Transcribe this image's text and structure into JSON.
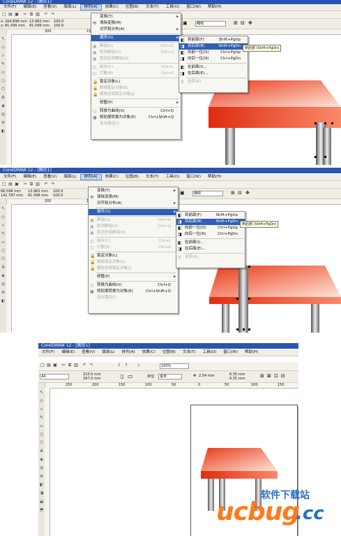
{
  "app_title_1": "CorelDRAW 12 - [图形1]",
  "app_title_2": "CorelDRAW 12 - [图形1]",
  "app_title_3": "CorelDRAW 12 - [图形1]",
  "menubar": [
    "文件(F)",
    "编辑(E)",
    "查看(V)",
    "版面(L)",
    "排列(A)",
    "效果(C)",
    "位图(B)",
    "文本(T)",
    "工具(O)",
    "窗口(W)",
    "帮助(H)"
  ],
  "panel1": {
    "x_pos": "164.898 mm",
    "y_pos": "81.096 mm",
    "w": "13.982 mm",
    "h": "81.096 mm",
    "scale_x": "100.0",
    "scale_y": "100.0",
    "outline": "细线",
    "ruler_ticks": [
      "200",
      "150"
    ]
  },
  "panel2": {
    "x_pos": "66.598 mm",
    "y_pos": "141.787 mm",
    "w": "13.982 mm",
    "h": "81.096 mm",
    "scale_x": "100.0",
    "scale_y": "100.0",
    "outline": "细线",
    "ruler_ticks": [
      "200",
      "150"
    ]
  },
  "panel3": {
    "page_size": "A4",
    "width": "210.0 mm",
    "height": "297.0 mm",
    "units_label": "单位:",
    "units": "毫米",
    "nudge": "2.54 mm",
    "dup_x": "6.35 mm",
    "dup_y": "6.35 mm",
    "zoom": "100%",
    "ruler_ticks": [
      "250",
      "200",
      "150",
      "100",
      "50",
      "0",
      "50",
      "100",
      "150"
    ]
  },
  "arrange_menu": [
    {
      "label": "变换(T)",
      "shortcut": "",
      "arrow": true,
      "disabled": false,
      "icon": ""
    },
    {
      "label": "清除变换(M)",
      "shortcut": "",
      "arrow": false,
      "disabled": false,
      "icon": "⟲"
    },
    {
      "label": "对齐和分布(A)",
      "shortcut": "",
      "arrow": true,
      "disabled": false,
      "icon": ""
    },
    {
      "label": "顺序(O)",
      "shortcut": "",
      "arrow": true,
      "disabled": false,
      "icon": ""
    },
    {
      "label": "群组(G)",
      "shortcut": "Ctrl+G",
      "arrow": false,
      "disabled": true,
      "icon": "▣"
    },
    {
      "label": "取消群组(U)",
      "shortcut": "Ctrl+U",
      "arrow": false,
      "disabled": true,
      "icon": "▣"
    },
    {
      "label": "取消全部群组(N)",
      "shortcut": "",
      "arrow": false,
      "disabled": true,
      "icon": "▣"
    },
    {
      "label": "结合(C)",
      "shortcut": "Ctrl+L",
      "arrow": false,
      "disabled": true,
      "icon": "◫"
    },
    {
      "label": "打散(B)",
      "shortcut": "Ctrl+K",
      "arrow": false,
      "disabled": true,
      "icon": "◫"
    },
    {
      "label": "锁定对象(L)",
      "shortcut": "",
      "arrow": false,
      "disabled": false,
      "icon": "🔒"
    },
    {
      "label": "解除锁定对象(K)",
      "shortcut": "",
      "arrow": false,
      "disabled": true,
      "icon": "🔓"
    },
    {
      "label": "解除全部锁定对象(J)",
      "shortcut": "",
      "arrow": false,
      "disabled": true,
      "icon": "🔓"
    },
    {
      "label": "修整(P)",
      "shortcut": "",
      "arrow": true,
      "disabled": false,
      "icon": ""
    },
    {
      "label": "转换为曲线(V)",
      "shortcut": "Ctrl+Q",
      "arrow": false,
      "disabled": false,
      "icon": "◌"
    },
    {
      "label": "将轮廓转换为对象(E)",
      "shortcut": "Ctrl+Shift+Q",
      "arrow": false,
      "disabled": false,
      "icon": "◍"
    },
    {
      "label": "连合路径(I)",
      "shortcut": "",
      "arrow": false,
      "disabled": true,
      "icon": ""
    }
  ],
  "order_menu": [
    {
      "label": "到前部(F)",
      "shortcut": "Shift+PgUp",
      "disabled": false,
      "icon": "◧"
    },
    {
      "label": "到后部(B)",
      "shortcut": "Shift+PgDn",
      "disabled": false,
      "icon": "◨"
    },
    {
      "label": "向前一位(O)",
      "shortcut": "Ctrl+PgUp",
      "disabled": false,
      "icon": "◧"
    },
    {
      "label": "向后一位(N)",
      "shortcut": "Ctrl+PgDn",
      "disabled": false,
      "icon": "◨"
    },
    {
      "label": "在前面(I)...",
      "shortcut": "",
      "disabled": false,
      "icon": "◧"
    },
    {
      "label": "在后面(E)...",
      "shortcut": "",
      "disabled": false,
      "icon": "◨"
    },
    {
      "label": "逆序(R)",
      "shortcut": "",
      "disabled": true,
      "icon": "⇅"
    }
  ],
  "tooltip": "到后部 (Shift+PgDn)",
  "watermark": {
    "brand": "ucbug",
    "cc": ".cc",
    "cn": "软件下载站"
  },
  "colors": {
    "tabletop_top": "#f35a2a",
    "tabletop_front": "#e8301a",
    "leg_light": "#e8e8e8",
    "leg_dark": "#5a5a5a",
    "title_blue": "#2a55b0",
    "menu_highlight": "#2f5fb3"
  }
}
